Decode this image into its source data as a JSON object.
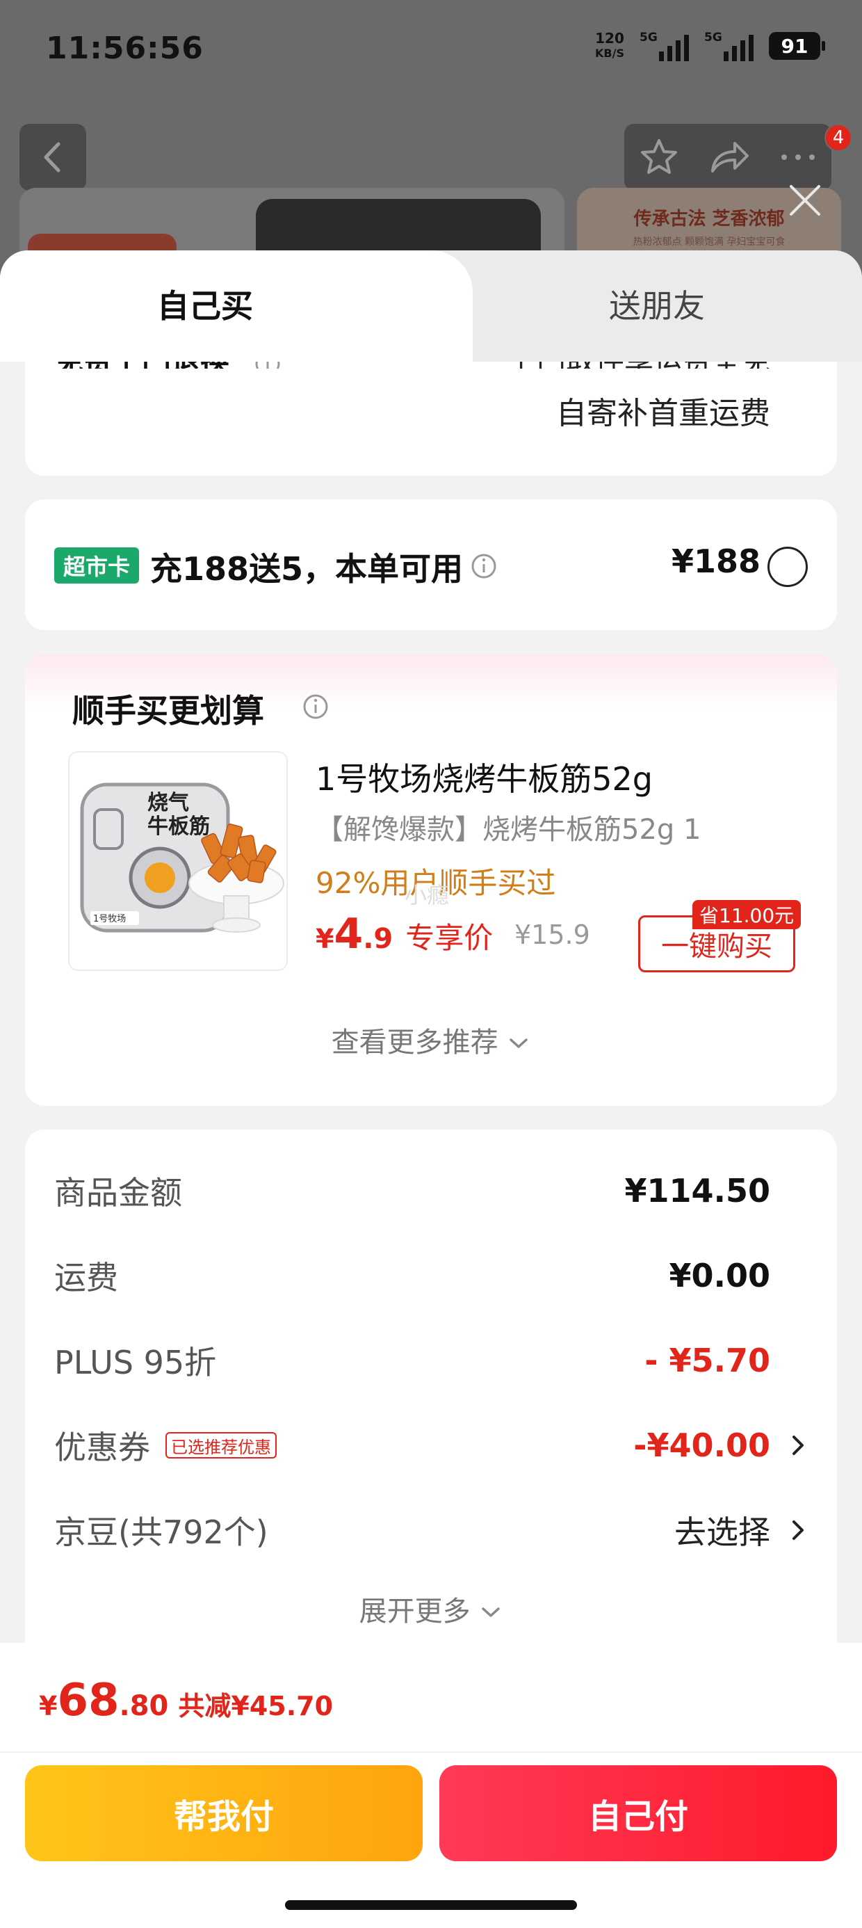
{
  "status_bar": {
    "time": "11:56:56",
    "net_speed_value": "120",
    "net_speed_unit": "KB/S",
    "signal1_tag": "5G",
    "signal2_tag": "5G",
    "battery": "91"
  },
  "top_nav": {
    "badge_count": "4"
  },
  "background_banner": {
    "title": "传承古法 芝香浓郁",
    "subtitle": "热粉浓郁点 颗颗饱满 孕妇宝宝可食"
  },
  "tabs": {
    "self_buy": "自己买",
    "gift": "送朋友"
  },
  "shipping": {
    "left_label": "免费上门退换",
    "right_line1": "上门取件享运费全免",
    "right_line2": "自寄补首重运费"
  },
  "market_card": {
    "tag": "超市卡",
    "text": "充188送5，本单可用",
    "price": "¥188"
  },
  "recommend": {
    "title": "顺手买更划算",
    "product_name": "1号牧场烧烤牛板筋52g",
    "product_sub": "【解馋爆款】烧烤牛板筋52g  1",
    "rate": "92%用户顺手买过",
    "price_symbol": "¥",
    "price_int": "4",
    "price_dec": ".9",
    "price_label": "专享价",
    "old_price": "¥15.9",
    "watermark": "小瘾",
    "save_badge": "省11.00元",
    "buy_button": "一键购买",
    "more": "查看更多推荐",
    "image_text_1": "烧气",
    "image_text_2": "牛板筋",
    "image_brand": "1号牧场"
  },
  "summary": {
    "goods_label": "商品金额",
    "goods_value": "¥114.50",
    "freight_label": "运费",
    "freight_value": "¥0.00",
    "plus_label": "PLUS 95折",
    "plus_value": "- ¥5.70",
    "coupon_label": "优惠券",
    "coupon_tag": "已选推荐优惠",
    "coupon_value": "-¥40.00",
    "jingdou_label": "京豆(共792个)",
    "jingdou_value": "去选择",
    "expand": "展开更多"
  },
  "footer": {
    "yen": "¥",
    "total_int": "68",
    "total_dec": ".80",
    "discount": "共减¥45.70",
    "help_pay": "帮我付",
    "self_pay": "自己付"
  },
  "colors": {
    "accent_red": "#e1251b",
    "market_green": "#1aa86b",
    "help_yellow": "#ffb414",
    "self_red": "#ff2a3d"
  }
}
